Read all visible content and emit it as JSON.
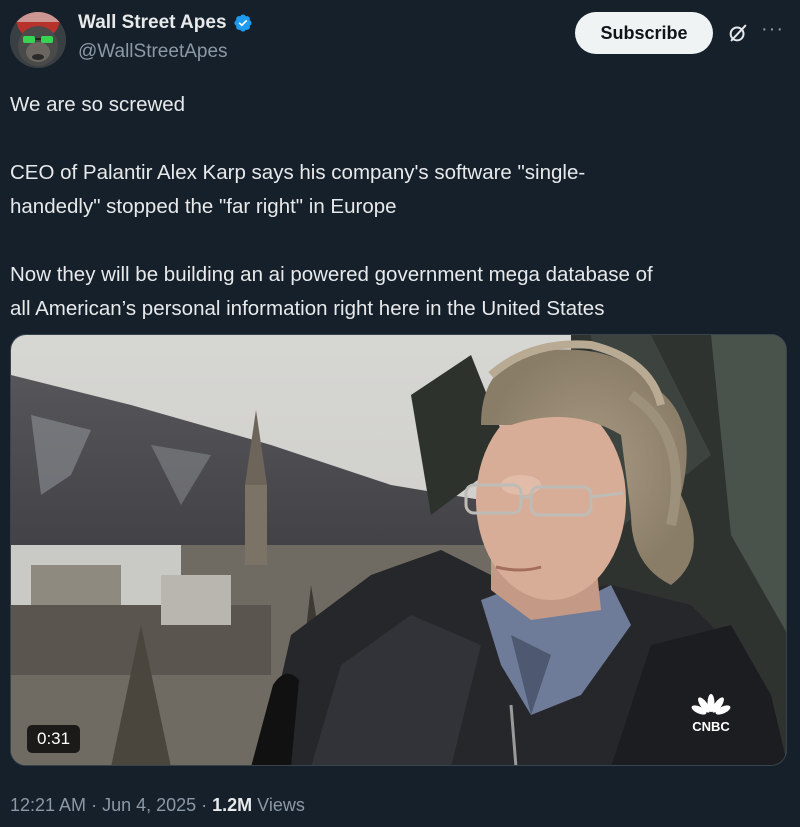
{
  "author": {
    "display_name": "Wall Street Apes",
    "handle": "@WallStreetApes",
    "verified": true,
    "verified_color": "#1d9bf0"
  },
  "actions": {
    "subscribe_label": "Subscribe",
    "grok_icon": "grok-icon",
    "more_label": "···"
  },
  "tweet": {
    "line1": "We are so screwed",
    "line2a": "CEO of Palantir Alex Karp says his company's software \"single-",
    "line2b": "handedly\" stopped the \"far right\" in Europe",
    "line3a": "Now they will be building an ai powered government mega database of",
    "line3b": "all American’s personal information right here in the United States"
  },
  "media": {
    "type": "video",
    "duration": "0:31",
    "watermark": "CNBC"
  },
  "meta": {
    "time": "12:21 AM",
    "separator": " · ",
    "date": "Jun 4, 2025",
    "views_count": "1.2M",
    "views_label": " Views"
  },
  "colors": {
    "background": "#15202b",
    "text_primary": "#e7e9ea",
    "text_secondary": "#8b98a5",
    "button_bg": "#eff3f4"
  }
}
